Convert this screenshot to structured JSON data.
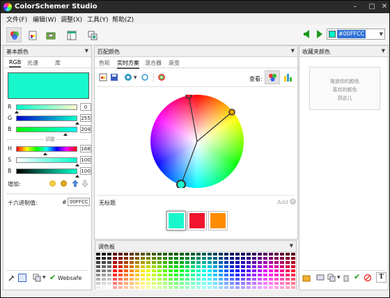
{
  "window": {
    "title": "ColorSchemer Studio"
  },
  "menu": [
    "文件(F)",
    "编辑(W)",
    "调整(X)",
    "工具(Y)",
    "帮助(Z)"
  ],
  "toolbar": {
    "buttons": [
      "color-wheel-icon",
      "document-icon",
      "folder-icon",
      "table-icon",
      "copy-icon"
    ],
    "hex_value": "#00FFCC",
    "swatch_color": "#00FFCC"
  },
  "left_panel": {
    "title": "基本颜色",
    "tabs": [
      "RGB",
      "光谱",
      "库"
    ],
    "active_tab": "RGB",
    "current_color": "#19F8CC",
    "rgb": [
      {
        "label": "R",
        "value": "0"
      },
      {
        "label": "G",
        "value": "255"
      },
      {
        "label": "B",
        "value": "204"
      }
    ],
    "adjust_label": "调整",
    "hsb": [
      {
        "label": "H",
        "value": "168"
      },
      {
        "label": "S",
        "value": "100"
      },
      {
        "label": "B",
        "value": "100"
      }
    ],
    "add_label": "增加:",
    "hex_label": "十六进制值:",
    "hex_hash": "#",
    "hex_value": "00FFCC",
    "websafe_label": "Websafe"
  },
  "middle_panel": {
    "title": "匹配颜色",
    "tabs": [
      "色轮",
      "实时方案",
      "混合器",
      "渐变"
    ],
    "active_tab": "实时方案",
    "view_label": "查看:",
    "scheme_title": "无标题",
    "add_label": "Add",
    "swatches": [
      "#19F8CC",
      "#F0142C",
      "#FF8C00"
    ],
    "palette_title": "调色板"
  },
  "right_panel": {
    "title": "收藏夹颜色",
    "drop_hint": [
      "拖放你的颜色",
      "喜欢的颜色",
      "到这儿"
    ]
  }
}
